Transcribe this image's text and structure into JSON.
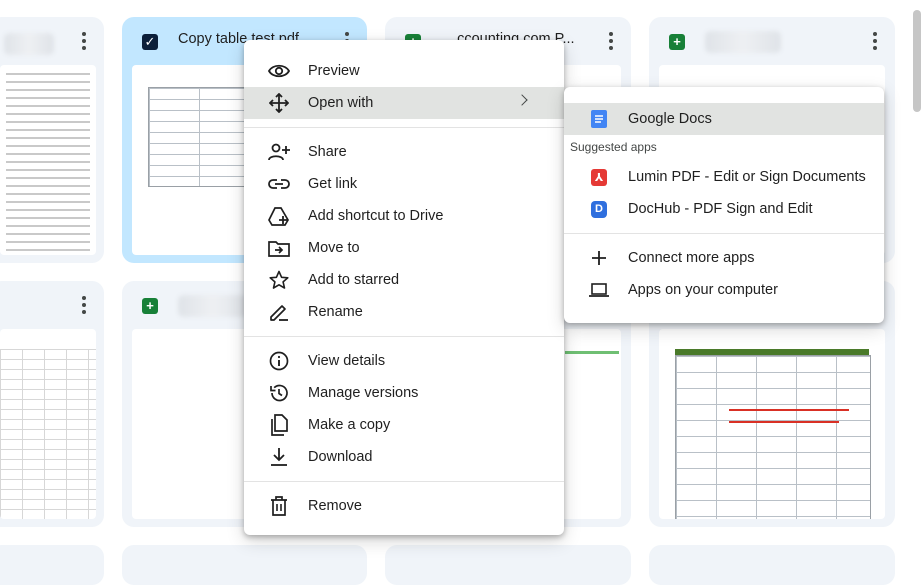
{
  "files": {
    "card1": {
      "title": ""
    },
    "card2": {
      "title": "Copy table test.pdf"
    },
    "card3": {
      "title": "... ccounting.com P..."
    },
    "card4": {
      "title": ""
    }
  },
  "menu": {
    "items": [
      {
        "label": "Preview",
        "icon": "eye-icon"
      },
      {
        "label": "Open with",
        "icon": "move-arrows-icon"
      },
      {
        "label": "Share",
        "icon": "person-add-icon"
      },
      {
        "label": "Get link",
        "icon": "link-icon"
      },
      {
        "label": "Add shortcut to Drive",
        "icon": "drive-shortcut-icon"
      },
      {
        "label": "Move to",
        "icon": "folder-move-icon"
      },
      {
        "label": "Add to starred",
        "icon": "star-icon"
      },
      {
        "label": "Rename",
        "icon": "pencil-icon"
      },
      {
        "label": "View details",
        "icon": "info-icon"
      },
      {
        "label": "Manage versions",
        "icon": "history-icon"
      },
      {
        "label": "Make a copy",
        "icon": "copy-icon"
      },
      {
        "label": "Download",
        "icon": "download-icon"
      },
      {
        "label": "Remove",
        "icon": "trash-icon"
      }
    ]
  },
  "submenu": {
    "default_app": {
      "label": "Google Docs",
      "icon": "google-docs-icon",
      "color": "#4285f4"
    },
    "suggested_caption": "Suggested apps",
    "suggested": [
      {
        "label": "Lumin PDF - Edit or Sign Documents",
        "icon": "lumin-pdf-icon",
        "color": "#e53935"
      },
      {
        "label": "DocHub - PDF Sign and Edit",
        "icon": "dochub-icon",
        "color": "#2f6fde"
      }
    ],
    "more": [
      {
        "label": "Connect more apps",
        "icon": "plus-icon"
      },
      {
        "label": "Apps on your computer",
        "icon": "laptop-icon"
      }
    ]
  },
  "colors": {
    "selected_card": "#c2e7ff",
    "card_bg": "#f0f4f9",
    "sheet_green": "#188038"
  }
}
